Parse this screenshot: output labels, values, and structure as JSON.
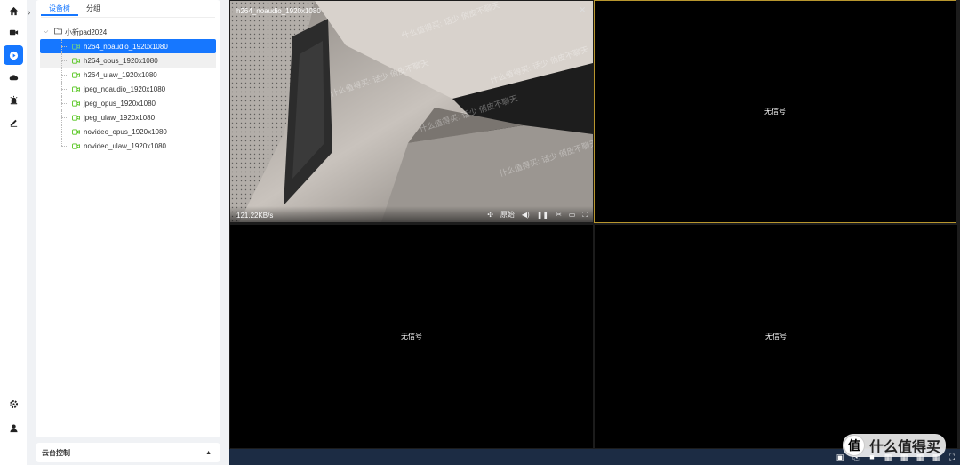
{
  "sidebar": {
    "icons": [
      "home-icon",
      "video-camera-icon",
      "playback-icon",
      "cloud-icon",
      "alarm-icon",
      "edit-icon",
      "settings-icon",
      "user-icon"
    ]
  },
  "panel": {
    "tabs": [
      {
        "label": "设备树",
        "active": true
      },
      {
        "label": "分组",
        "active": false
      }
    ],
    "tree": {
      "root": "小新pad2024",
      "items": [
        {
          "label": "h264_noaudio_1920x1080",
          "selected": true
        },
        {
          "label": "h264_opus_1920x1080"
        },
        {
          "label": "h264_ulaw_1920x1080"
        },
        {
          "label": "jpeg_noaudio_1920x1080"
        },
        {
          "label": "jpeg_opus_1920x1080"
        },
        {
          "label": "jpeg_ulaw_1920x1080"
        },
        {
          "label": "novideo_opus_1920x1080"
        },
        {
          "label": "novideo_ulaw_1920x1080"
        }
      ]
    },
    "ptz_label": "云台控制"
  },
  "video": {
    "active_title": "h264_noaudio_1920x1080",
    "bitrate": "121.22KB/s",
    "mode_label": "原始",
    "watermark": "什么值得买: 话少 俏皮不聊天",
    "no_signal": "无信号"
  },
  "branding": {
    "logo_char": "值",
    "logo_text": "什么值得买"
  },
  "colors": {
    "accent": "#1677ff",
    "focus_border": "#b8962e",
    "bottom_bar": "#1c2c44"
  }
}
